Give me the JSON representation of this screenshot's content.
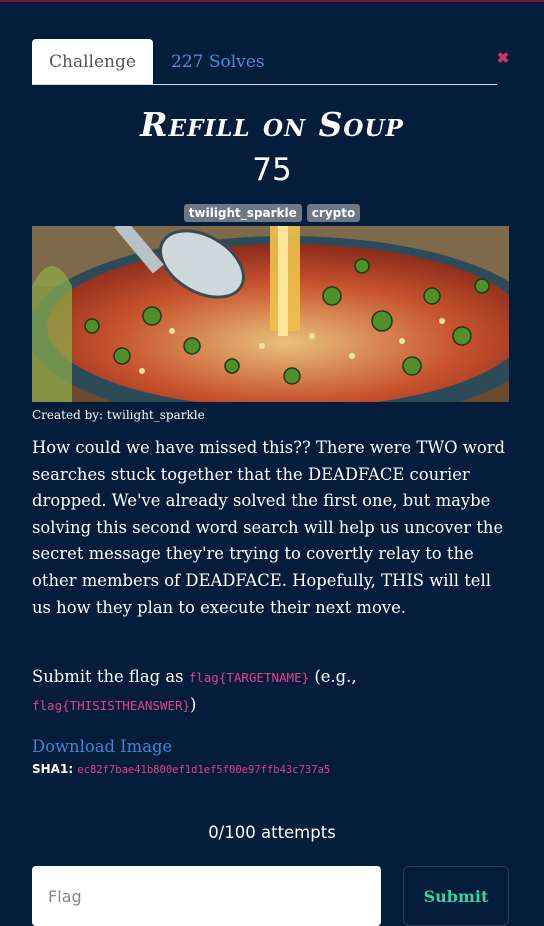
{
  "tabs": {
    "challenge": "Challenge",
    "solves": "227 Solves"
  },
  "challenge": {
    "name": "Refill on Soup",
    "value": "75",
    "tags": [
      "twilight_sparkle",
      "crypto"
    ],
    "created_by": "Created by: twilight_sparkle",
    "description": "How could we have missed this?? There were TWO word searches stuck together that the DEADFACE courier dropped. We've already solved the first one, but maybe solving this second word search will help us uncover the secret message they're trying to covertly relay to the other members of DEADFACE. Hopefully, THIS will tell us how they plan to execute their next move.",
    "submit_prefix": "Submit the flag as ",
    "flag_format": "flag{TARGETNAME}",
    "submit_mid": " (e.g., ",
    "flag_example": "flag{THISISTHEANSWER}",
    "submit_suffix": ")",
    "download_label": "Download Image",
    "sha_label": "SHA1: ",
    "sha_value": "ec82f7bae41b800ef1d1ef5f00e97ffb43c737a5"
  },
  "attempts": "0/100 attempts",
  "form": {
    "placeholder": "Flag",
    "submit_label": "Submit"
  }
}
